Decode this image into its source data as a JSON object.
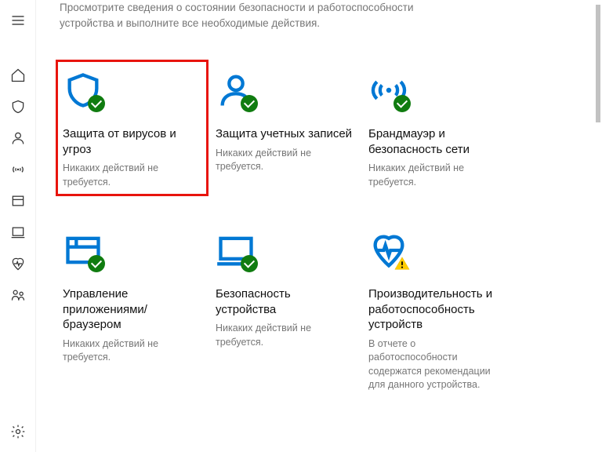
{
  "intro": "Просмотрите сведения о состоянии безопасности и работоспособности устройства и выполните все необходимые действия.",
  "sidebar": {
    "items": [
      {
        "name": "hamburger-icon"
      },
      {
        "name": "home-icon"
      },
      {
        "name": "shield-icon"
      },
      {
        "name": "account-icon"
      },
      {
        "name": "signal-icon"
      },
      {
        "name": "app-browser-icon"
      },
      {
        "name": "device-icon"
      },
      {
        "name": "health-icon"
      },
      {
        "name": "family-icon"
      },
      {
        "name": "settings-icon"
      }
    ]
  },
  "tiles": [
    {
      "id": "virus",
      "title": "Защита от вирусов и угроз",
      "desc": "Никаких действий не требуется.",
      "status": "ok",
      "highlight": true
    },
    {
      "id": "account",
      "title": "Защита учетных записей",
      "desc": "Никаких действий не требуется.",
      "status": "ok",
      "highlight": false
    },
    {
      "id": "firewall",
      "title": "Брандмауэр и безопасность сети",
      "desc": "Никаких действий не требуется.",
      "status": "ok",
      "highlight": false
    },
    {
      "id": "appbrowser",
      "title": "Управление приложениями/браузером",
      "desc": "Никаких действий не требуется.",
      "status": "ok",
      "highlight": false
    },
    {
      "id": "devicesec",
      "title": "Безопасность устройства",
      "desc": "Никаких действий не требуется.",
      "status": "ok",
      "highlight": false
    },
    {
      "id": "health",
      "title": "Производительность и работоспособность устройств",
      "desc": "В отчете о работоспособности содержатся рекомендации для данного устройства.",
      "status": "warn",
      "highlight": false
    }
  ]
}
